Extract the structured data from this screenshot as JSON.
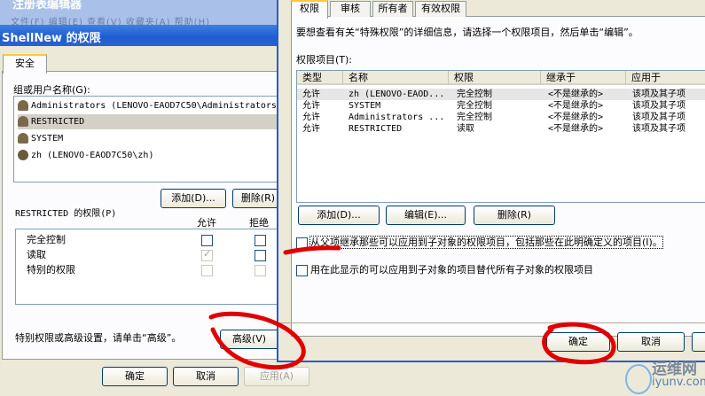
{
  "back_window": {
    "regedit_title": "注册表编辑器",
    "regedit_menu": "文件(F)  编辑(E)  查看(V)  收藏夹(A)  帮助(H)",
    "title": "ShellNew 的权限",
    "tab": "安全",
    "group_label": "组或用户名称(G):",
    "users": [
      {
        "name": "Administrators (LENOVO-EAOD7C50\\Administrators)"
      },
      {
        "name": "RESTRICTED"
      },
      {
        "name": "SYSTEM"
      },
      {
        "name": "zh (LENOVO-EAOD7C50\\zh)"
      }
    ],
    "add_button": "添加(D)...",
    "remove_button": "删除(R)",
    "perm_label": "RESTRICTED 的权限(P)",
    "col_allow": "允许",
    "col_deny": "拒绝",
    "permissions": [
      {
        "name": "完全控制",
        "allow": false,
        "deny": false
      },
      {
        "name": "读取",
        "allow": true,
        "deny": false
      },
      {
        "name": "特别的权限",
        "allow": false,
        "deny": false
      }
    ],
    "special_text": "特别权限或高级设置，请单击“高级”。",
    "advanced_button": "高级(V)",
    "ok_button": "确定",
    "cancel_button": "取消",
    "apply_button": "应用(A)"
  },
  "front_window": {
    "tabs": [
      "权限",
      "审核",
      "所有者",
      "有效权限"
    ],
    "description": "要想查看有关“特殊权限”的详细信息，请选择一个权限项目，然后单击“编辑”。",
    "entries_label": "权限项目(T):",
    "columns": [
      "类型",
      "名称",
      "权限",
      "继承于",
      "应用于"
    ],
    "entries": [
      {
        "type": "允许",
        "name": "zh (LENOVO-EAOD...",
        "perm": "完全控制",
        "inherit": "<不是继承的>",
        "apply": "该项及其子项"
      },
      {
        "type": "允许",
        "name": "SYSTEM",
        "perm": "完全控制",
        "inherit": "<不是继承的>",
        "apply": "该项及其子项"
      },
      {
        "type": "允许",
        "name": "Administrators ...",
        "perm": "完全控制",
        "inherit": "<不是继承的>",
        "apply": "该项及其子项"
      },
      {
        "type": "允许",
        "name": "RESTRICTED",
        "perm": "读取",
        "inherit": "<不是继承的>",
        "apply": "该项及其子项"
      }
    ],
    "add_button": "添加(D)...",
    "edit_button": "编辑(E)...",
    "remove_button": "删除(R)",
    "inherit_checkbox": "从父项继承那些可以应用到子对象的权限项目，包括那些在此明确定义的项目(I)。",
    "replace_checkbox": "用在此显示的可以应用到子对象的项目替代所有子对象的权限项目",
    "ok_button": "确定",
    "cancel_button": "取消"
  },
  "watermark": {
    "brand": "运维网",
    "url": "iyunv.com"
  },
  "colors": {
    "annotation": "#e00000",
    "xp_blue": "#2a5cc8"
  }
}
